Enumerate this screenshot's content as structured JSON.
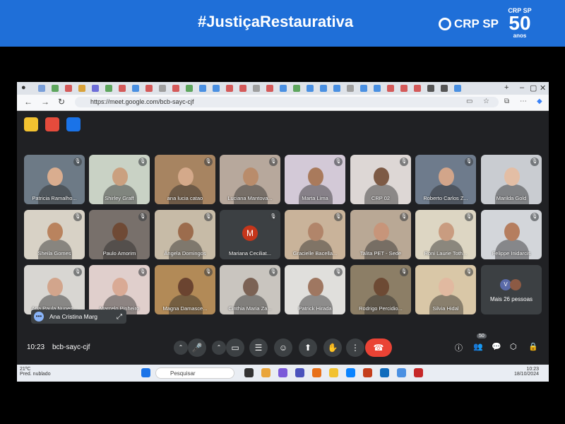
{
  "banner": {
    "title": "#JustiçaRestaurativa",
    "logo_text": "CRP SP",
    "anniversary_top": "CRP SP",
    "anniversary_number": "50",
    "anniversary_bottom": "anos"
  },
  "browser": {
    "url": "https://meet.google.com/bcb-sayc-cjf"
  },
  "participants": [
    {
      "name": "Patricia Ramalho...",
      "bg": "#6d7a86",
      "skin": "#d9ad8f"
    },
    {
      "name": "Shirley Graff",
      "bg": "#c9d2c5",
      "skin": "#caa07f"
    },
    {
      "name": "ana lucia catao",
      "bg": "#a78461",
      "skin": "#d4a98a"
    },
    {
      "name": "Luciana Mantova...",
      "bg": "#b7a89c",
      "skin": "#b98c6b"
    },
    {
      "name": "Marta Lima",
      "bg": "#d3c9d7",
      "skin": "#a97a5c"
    },
    {
      "name": "CRP 02",
      "bg": "#ddd7d5",
      "skin": "#7d5a45"
    },
    {
      "name": "Roberto Carlos Z...",
      "bg": "#6e7b8c",
      "skin": "#d2a58a"
    },
    {
      "name": "Marilda Gold",
      "bg": "#c9ccd1",
      "skin": "#e3bea5"
    },
    {
      "name": "Sheila Gomes",
      "bg": "#d8d2c6",
      "skin": "#b9835e"
    },
    {
      "name": "Paulo Amorim",
      "bg": "#78706b",
      "skin": "#6f4a35"
    },
    {
      "name": "Ângela Domingos",
      "bg": "#c7bba7",
      "skin": "#9c6c4d"
    },
    {
      "name": "Mariana Ceciliat...",
      "bg": "#3c4043",
      "skin": "",
      "initial": "M"
    },
    {
      "name": "Gracielle Bacella...",
      "bg": "#c9b39a",
      "skin": "#b1856a"
    },
    {
      "name": "Talita PET - Sede",
      "bg": "#b9a895",
      "skin": "#c7957a"
    },
    {
      "name": "Roni Laurie Toth...",
      "bg": "#ddd6c3",
      "skin": "#c99c80"
    },
    {
      "name": "Felippe Inidarcis",
      "bg": "#d3d6da",
      "skin": "#b57e5f"
    },
    {
      "name": "Ana Paula Nunes...",
      "bg": "#d8d6d2",
      "skin": "#d2a58c"
    },
    {
      "name": "Marcelo Pinheiro",
      "bg": "#e0cfcc",
      "skin": "#d9aa95"
    },
    {
      "name": "Magna Damasce...",
      "bg": "#b28a57",
      "skin": "#6b4430"
    },
    {
      "name": "Cinthia Maria Za...",
      "bg": "#c9c5bf",
      "skin": "#7b6254"
    },
    {
      "name": "Patrick Hirada",
      "bg": "#e0dfdc",
      "skin": "#9f7761"
    },
    {
      "name": "Rodrigo Percidio...",
      "bg": "#8c7e66",
      "skin": "#6d4a34"
    },
    {
      "name": "Silvia Hidal",
      "bg": "#d9c7a7",
      "skin": "#e1b9a0"
    }
  ],
  "more_tile": {
    "label": "Mais 26 pessoas",
    "avatar_initial": "V"
  },
  "pinned": {
    "name": "Ana Cristina Marg"
  },
  "controls": {
    "time": "10:23",
    "meeting_code": "bcb-sayc-cjf",
    "participants_count": "50"
  },
  "taskbar": {
    "temperature": "21ºC",
    "weather": "Pred. nublado",
    "search_placeholder": "Pesquisar",
    "time": "10:23",
    "date": "18/10/2024"
  }
}
